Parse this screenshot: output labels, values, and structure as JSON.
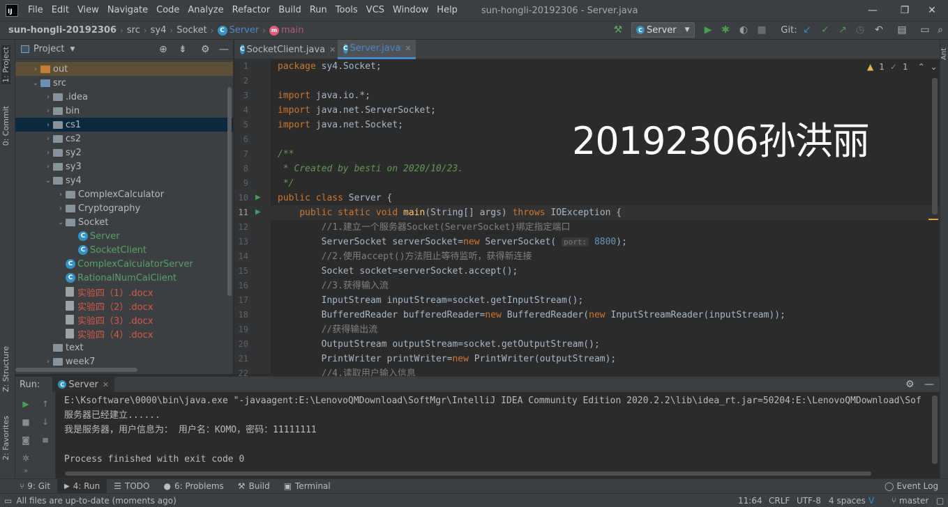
{
  "title_bar": {
    "menu": [
      "File",
      "Edit",
      "View",
      "Navigate",
      "Code",
      "Analyze",
      "Refactor",
      "Build",
      "Run",
      "Tools",
      "VCS",
      "Window",
      "Help"
    ],
    "window_title": "sun-hongli-20192306 - Server.java"
  },
  "nav_bar": {
    "breadcrumbs": [
      "sun-hongli-20192306",
      "src",
      "sy4",
      "Socket",
      "Server",
      "main"
    ],
    "run_config": "Server",
    "git_label": "Git:"
  },
  "left_strip": {
    "project": "1: Project",
    "commit": "0: Commit",
    "structure": "Z: Structure",
    "favorites": "2: Favorites"
  },
  "right_strip": {
    "ant": "Ant"
  },
  "project_panel": {
    "title": "Project",
    "tree": [
      {
        "label": "out",
        "arrow": "›",
        "icon": "folder-orange",
        "style": "",
        "row": "hl",
        "indent": 1
      },
      {
        "label": "src",
        "arrow": "⌄",
        "icon": "folder-blue",
        "style": "",
        "row": "",
        "indent": 1
      },
      {
        "label": ".idea",
        "arrow": "›",
        "icon": "folder",
        "style": "",
        "row": "",
        "indent": 2
      },
      {
        "label": "bin",
        "arrow": "›",
        "icon": "folder",
        "style": "",
        "row": "",
        "indent": 2
      },
      {
        "label": "cs1",
        "arrow": "›",
        "icon": "folder",
        "style": "",
        "row": "sel",
        "indent": 2
      },
      {
        "label": "cs2",
        "arrow": "›",
        "icon": "folder",
        "style": "",
        "row": "",
        "indent": 2
      },
      {
        "label": "sy2",
        "arrow": "›",
        "icon": "folder",
        "style": "",
        "row": "",
        "indent": 2
      },
      {
        "label": "sy3",
        "arrow": "›",
        "icon": "folder",
        "style": "",
        "row": "",
        "indent": 2
      },
      {
        "label": "sy4",
        "arrow": "⌄",
        "icon": "folder",
        "style": "",
        "row": "",
        "indent": 2
      },
      {
        "label": "ComplexCalculator",
        "arrow": "›",
        "icon": "folder",
        "style": "",
        "row": "",
        "indent": 3
      },
      {
        "label": "Cryptography",
        "arrow": "›",
        "icon": "folder",
        "style": "",
        "row": "",
        "indent": 3
      },
      {
        "label": "Socket",
        "arrow": "⌄",
        "icon": "folder",
        "style": "",
        "row": "",
        "indent": 3
      },
      {
        "label": "Server",
        "arrow": "",
        "icon": "class",
        "style": "green",
        "row": "",
        "indent": 4
      },
      {
        "label": "SocketClient",
        "arrow": "",
        "icon": "class",
        "style": "green",
        "row": "",
        "indent": 4
      },
      {
        "label": "ComplexCalculatorServer",
        "arrow": "",
        "icon": "class",
        "style": "green",
        "row": "",
        "indent": 3
      },
      {
        "label": "RationalNumCalClient",
        "arrow": "",
        "icon": "class",
        "style": "green",
        "row": "",
        "indent": 3
      },
      {
        "label": "实验四（1）.docx",
        "arrow": "",
        "icon": "docx",
        "style": "red",
        "row": "",
        "indent": 3
      },
      {
        "label": "实验四（2）.docx",
        "arrow": "",
        "icon": "docx",
        "style": "red",
        "row": "",
        "indent": 3
      },
      {
        "label": "实验四（3）.docx",
        "arrow": "",
        "icon": "docx",
        "style": "red",
        "row": "",
        "indent": 3
      },
      {
        "label": "实验四（4）.docx",
        "arrow": "",
        "icon": "docx",
        "style": "red",
        "row": "",
        "indent": 3
      },
      {
        "label": "text",
        "arrow": "",
        "icon": "folder",
        "style": "",
        "row": "",
        "indent": 2
      },
      {
        "label": "week7",
        "arrow": "›",
        "icon": "folder",
        "style": "",
        "row": "",
        "indent": 2
      }
    ]
  },
  "editor": {
    "tabs": [
      "SocketClient.java",
      "Server.java"
    ],
    "active_tab": "Server.java",
    "inspection": {
      "warnings": "1",
      "weak": "1"
    },
    "overlay_text": "20192306孙洪丽",
    "current_line": 11,
    "lines": [
      {
        "n": "1",
        "html": "<span class=\"kw\">package</span> sy4.Socket;"
      },
      {
        "n": "2",
        "html": ""
      },
      {
        "n": "3",
        "html": "<span class=\"kw\">import</span> java.io.*;"
      },
      {
        "n": "4",
        "html": "<span class=\"kw\">import</span> java.net.ServerSocket;"
      },
      {
        "n": "5",
        "html": "<span class=\"kw\">import</span> java.net.Socket;"
      },
      {
        "n": "6",
        "html": ""
      },
      {
        "n": "7",
        "html": "<span class=\"doc\">/**</span>"
      },
      {
        "n": "8",
        "html": "<span class=\"doc\"> * Created by besti on 2020/10/23.</span>"
      },
      {
        "n": "9",
        "html": "<span class=\"doc\"> */</span>"
      },
      {
        "n": "10",
        "html": "<span class=\"kw\">public class</span> Server {"
      },
      {
        "n": "11",
        "html": "    <span class=\"kw\">public static void</span> <span class=\"fn\">main</span>(String[] args) <span class=\"kw\">throws</span> IOException {"
      },
      {
        "n": "12",
        "html": "        <span class=\"cm\">//1.建立一个服务器Socket(ServerSocket)绑定指定端口</span>"
      },
      {
        "n": "13",
        "html": "        ServerSocket serverSocket=<span class=\"kw\">new</span> ServerSocket( <span class=\"hint\">port:</span> <span class=\"num\">8800</span>);"
      },
      {
        "n": "14",
        "html": "        <span class=\"cm\">//2.使用accept()方法阻止等待监听，获得新连接</span>"
      },
      {
        "n": "15",
        "html": "        Socket socket=serverSocket.accept();"
      },
      {
        "n": "16",
        "html": "        <span class=\"cm\">//3.获得输入流</span>"
      },
      {
        "n": "17",
        "html": "        InputStream inputStream=socket.getInputStream();"
      },
      {
        "n": "18",
        "html": "        BufferedReader bufferedReader=<span class=\"kw\">new</span> BufferedReader(<span class=\"kw\">new</span> InputStreamReader(inputStream));"
      },
      {
        "n": "19",
        "html": "        <span class=\"cm\">//获得输出流</span>"
      },
      {
        "n": "20",
        "html": "        OutputStream outputStream=socket.getOutputStream();"
      },
      {
        "n": "21",
        "html": "        PrintWriter printWriter=<span class=\"kw\">new</span> PrintWriter(outputStream);"
      },
      {
        "n": "22",
        "html": "        <span class=\"cm\">//4.读取用户输入信息</span>"
      }
    ]
  },
  "run_panel": {
    "label": "Run:",
    "tab": "Server",
    "console": [
      "E:\\Ksoftware\\0000\\bin\\java.exe \"-javaagent:E:\\LenovoQMDownload\\SoftMgr\\IntelliJ IDEA Community Edition 2020.2.2\\lib\\idea_rt.jar=50204:E:\\LenovoQMDownload\\Sof",
      "服务器已经建立......",
      "我是服务器，用户信息为： 用户名：KOMO，密码：11111111",
      "",
      "Process finished with exit code 0"
    ]
  },
  "bottom_tabs": [
    "9: Git",
    "4: Run",
    "TODO",
    "6: Problems",
    "Build",
    "Terminal"
  ],
  "event_log": "Event Log",
  "status_bar": {
    "message": "All files are up-to-date (moments ago)",
    "position": "11:64",
    "line_sep": "CRLF",
    "encoding": "UTF-8",
    "indent": "4 spaces",
    "branch": "master"
  },
  "colors": {
    "accent": "#4a88c7",
    "run_green": "#499c54",
    "keyword": "#cc7832"
  }
}
